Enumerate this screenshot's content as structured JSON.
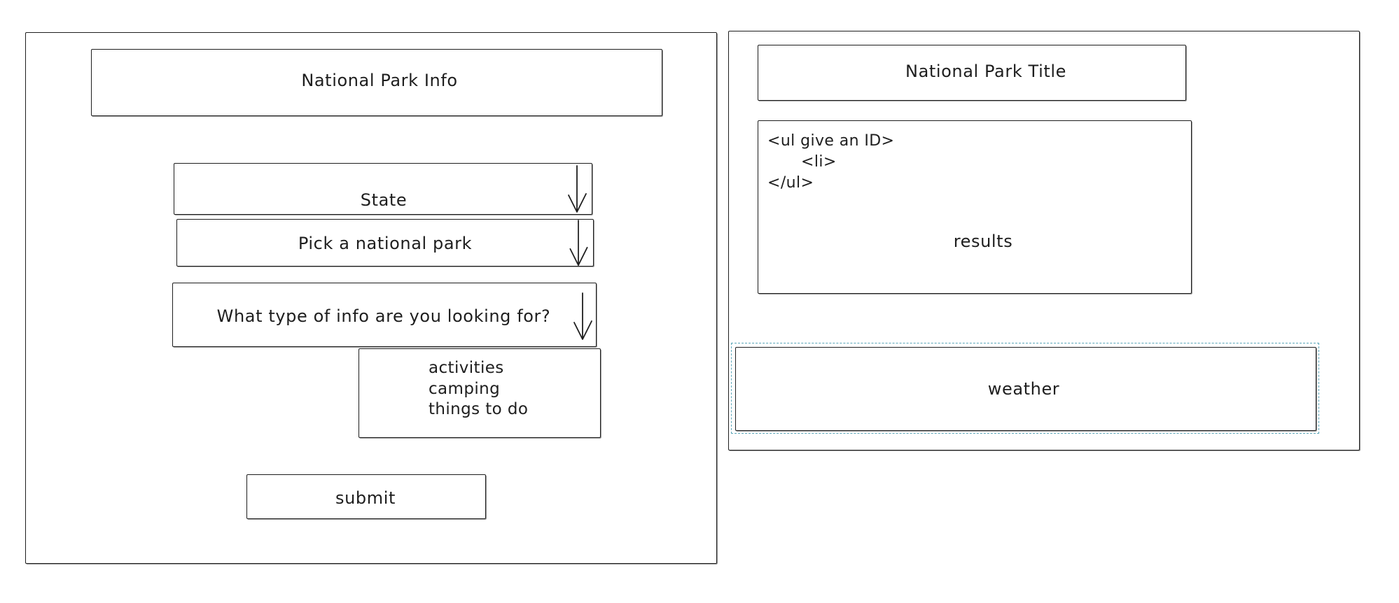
{
  "left_panel": {
    "title": "National Park Info",
    "state_select": "State",
    "park_select": "Pick a national park",
    "info_select": "What type of info are you looking for?",
    "info_options": [
      "activities",
      "camping",
      "things to do"
    ],
    "submit_label": "submit"
  },
  "right_panel": {
    "title": "National Park Title",
    "results_code": [
      "<ul give an ID>",
      "<li>",
      "</ul>"
    ],
    "results_label": "results",
    "weather_label": "weather"
  },
  "colors": {
    "stroke": "#1e1e1e",
    "selection": "#59a5b8",
    "background": "#ffffff"
  }
}
